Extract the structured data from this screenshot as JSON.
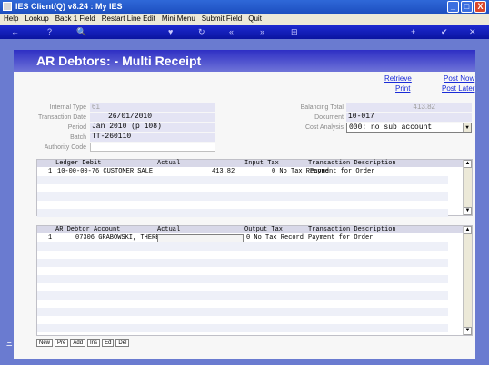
{
  "window": {
    "title": "IES Client(Q) v8.24 : My IES",
    "minimize": "_",
    "maximize": "□",
    "close": "X"
  },
  "menu": [
    "Help",
    "Lookup",
    "Back 1 Field",
    "Restart Line Edit",
    "Mini Menu",
    "Submit Field",
    "Quit"
  ],
  "toolbar": {
    "back": "←",
    "help": "?",
    "search": "🔍",
    "heart": "♥",
    "refresh": "↻",
    "rew": "«",
    "fwd": "»",
    "doc": "⊞",
    "add": "+",
    "ok": "✔",
    "cancel": "✕"
  },
  "page": {
    "title": "AR Debtors: - Multi Receipt"
  },
  "actions": {
    "retrieve": "Retrieve",
    "print": "Print",
    "post_now": "Post Now",
    "post_later": "Post Later"
  },
  "form": {
    "internal_type_label": "Internal Type",
    "internal_type": "61",
    "transaction_date_label": "Transaction Date",
    "transaction_date": "26/01/2010",
    "period_label": "Period",
    "period": "Jan 2010 (p 108)",
    "batch_label": "Batch",
    "batch": "TT-260110",
    "authority_code_label": "Authority Code",
    "authority_code": "",
    "balancing_total_label": "Balancing Total",
    "balancing_total": "413.82",
    "document_label": "Document",
    "document": "10-017",
    "cost_analysis_label": "Cost Analysis",
    "cost_analysis": "000: no sub account"
  },
  "ledger_grid": {
    "headers": [
      "Ledger Debit",
      "Actual",
      "Input Tax",
      "Transaction Description"
    ],
    "rows": [
      {
        "num": "1",
        "account": "10-00-00-76 CUSTOMER SALE",
        "actual": "413.82",
        "tax": "0 No Tax Record",
        "desc": "Payment for Order"
      }
    ]
  },
  "debtor_grid": {
    "headers": [
      "AR Debtor Account",
      "Actual",
      "Output Tax",
      "Transaction Description"
    ],
    "rows": [
      {
        "num": "1",
        "account": "07306 GRABOWSKI, THERESA",
        "actual": "",
        "tax": "0 No Tax Record",
        "desc": "Payment for Order"
      }
    ]
  },
  "bottom_buttons": [
    "New",
    "Pre",
    "Add",
    "Ins",
    "Ed",
    "Del"
  ],
  "colors": {
    "accent": "#2e2fc4",
    "background": "#6a7bd0",
    "link": "#1a2bd8"
  }
}
